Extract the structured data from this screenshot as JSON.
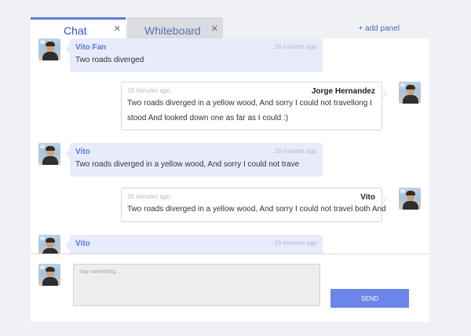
{
  "tabs": [
    {
      "label": "Chat",
      "close": "×",
      "active": true
    },
    {
      "label": "Whiteboard",
      "close": "×",
      "active": false
    }
  ],
  "add_panel": "+ add panel",
  "messages": [
    {
      "direction": "incoming",
      "sender": "Vito Fan",
      "time": "16 minutes ago",
      "text": "Two roads diverged"
    },
    {
      "direction": "outgoing",
      "sender": "Jorge Hernandez",
      "time": "16 minutes ago",
      "lines": [
        "Two roads diverged in a yellow wood, And sorry I could not travellong I",
        "stood And looked down one as far as I could :)"
      ]
    },
    {
      "direction": "incoming",
      "sender": "Vito",
      "time": "16 minutes ago",
      "text": "Two roads diverged in a yellow wood, And sorry I could not trave"
    },
    {
      "direction": "outgoing",
      "sender": "Vito",
      "time": "16 minutes ago",
      "text": "Two roads diverged in a yellow wood, And sorry I could not travel both And"
    },
    {
      "direction": "incoming",
      "sender": "Vito",
      "time": "16 minutes ago",
      "text": ""
    }
  ],
  "composer": {
    "placeholder": "Say something...",
    "value": "",
    "send_label": "SEND"
  },
  "colors": {
    "accent": "#5b7fdb",
    "incoming_bubble": "#e8ebfa",
    "send_button": "#6c85e8",
    "sender_name": "#5a78d6"
  },
  "icons": {
    "tab_close": "close-icon",
    "avatar": "user-avatar"
  }
}
